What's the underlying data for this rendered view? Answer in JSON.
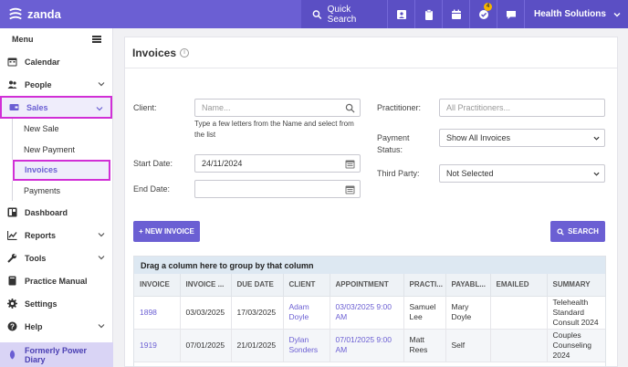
{
  "topbar": {
    "brand": "zanda",
    "quick_search": "Quick Search",
    "icons": [
      "contact-card-icon",
      "clipboard-icon",
      "calendar-add-icon",
      "tasks-icon",
      "chat-icon"
    ],
    "tasks_badge": "4",
    "company": "Health Solutions"
  },
  "sidebar": {
    "menu_label": "Menu",
    "items": [
      {
        "label": "Calendar",
        "icon": "calendar-icon"
      },
      {
        "label": "People",
        "icon": "people-icon"
      },
      {
        "label": "Sales",
        "icon": "wallet-icon"
      },
      {
        "label": "Dashboard",
        "icon": "dashboard-icon"
      },
      {
        "label": "Reports",
        "icon": "reports-icon"
      },
      {
        "label": "Tools",
        "icon": "wrench-icon"
      },
      {
        "label": "Practice Manual",
        "icon": "book-icon"
      },
      {
        "label": "Settings",
        "icon": "gear-icon"
      },
      {
        "label": "Help",
        "icon": "help-icon"
      }
    ],
    "sales_sub": [
      "New Sale",
      "New Payment",
      "Invoices",
      "Payments"
    ],
    "bottom": "Formerly Power Diary"
  },
  "page": {
    "title": "Invoices",
    "info": "i"
  },
  "filters": {
    "client_label": "Client:",
    "client_placeholder": "Name...",
    "client_help": "Type a few letters from the Name and select from the list",
    "start_label": "Start Date:",
    "start_value": "24/11/2024",
    "end_label": "End Date:",
    "end_value": "",
    "practitioner_label": "Practitioner:",
    "practitioner_placeholder": "All Practitioners...",
    "payment_label": "Payment Status:",
    "payment_value": "Show All Invoices",
    "third_label": "Third Party:",
    "third_value": "Not Selected"
  },
  "buttons": {
    "new_invoice": "+ NEW INVOICE",
    "search": "SEARCH"
  },
  "grid": {
    "group_hint": "Drag a column here to group by that column",
    "columns": [
      "INVOICE",
      "INVOICE ...",
      "DUE DATE",
      "CLIENT",
      "APPOINTMENT",
      "PRACTI...",
      "PAYABL...",
      "EMAILED",
      "SUMMARY"
    ],
    "rows": [
      [
        "1898",
        "03/03/2025",
        "17/03/2025",
        "Adam Doyle",
        "03/03/2025 9:00 AM",
        "Samuel Lee",
        "Mary Doyle",
        "",
        "Telehealth Standard Consult 2024"
      ],
      [
        "1919",
        "07/01/2025",
        "21/01/2025",
        "Dylan Sonders",
        "07/01/2025 9:00 AM",
        "Matt Rees",
        "Self",
        "",
        "Couples Counseling 2024"
      ]
    ]
  },
  "colors": {
    "brand": "#6b5fd3",
    "highlight": "#d12fd6"
  }
}
